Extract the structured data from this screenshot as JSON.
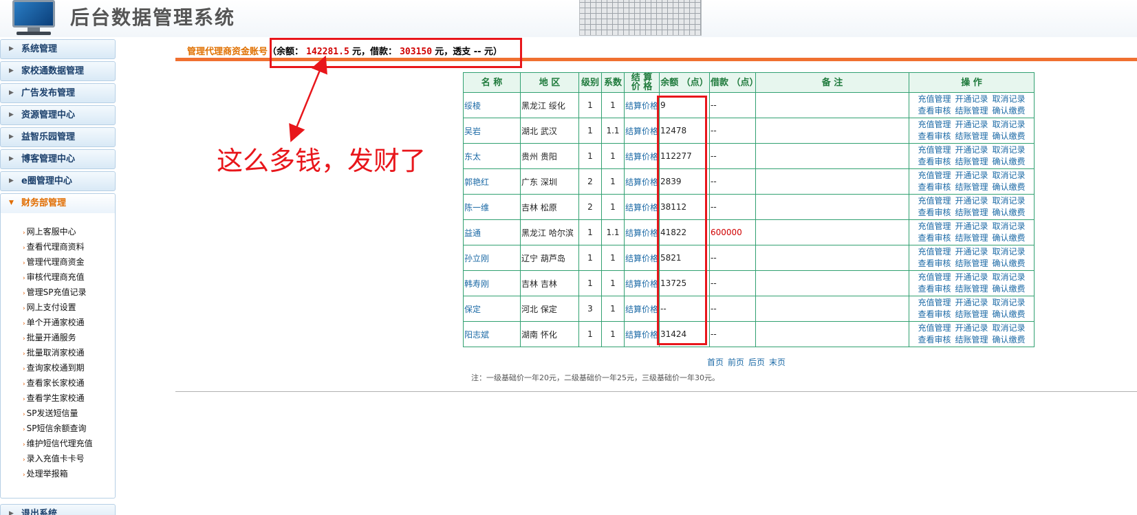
{
  "header": {
    "title": "后台数据管理系统"
  },
  "sidebar": {
    "menus": [
      {
        "label": "系统管理"
      },
      {
        "label": "家校通数据管理"
      },
      {
        "label": "广告发布管理"
      },
      {
        "label": "资源管理中心"
      },
      {
        "label": "益智乐园管理"
      },
      {
        "label": "博客管理中心"
      },
      {
        "label": "e圈管理中心"
      },
      {
        "label": "财务部管理"
      }
    ],
    "finance_items": [
      "网上客服中心",
      "查看代理商资料",
      "管理代理商资金",
      "审核代理商充值",
      "管理SP充值记录",
      "网上支付设置",
      "单个开通家校通",
      "批量开通服务",
      "批量取消家校通",
      "查询家校通到期",
      "查看家长家校通",
      "查看学生家校通",
      "SP发送短信量",
      "SP短信余额查询",
      "维护短信代理充值",
      "录入充值卡卡号",
      "处理举报箱"
    ],
    "exit_label": "退出系统"
  },
  "main": {
    "title_label": "管理代理商资金账号",
    "title_prefix": "（余额：",
    "balance": "142281.5",
    "title_mid1": "元，借款：",
    "loan": "303150",
    "title_mid2": "元，透支 -- 元）"
  },
  "table": {
    "headers": {
      "name": "名 称",
      "region": "地 区",
      "level": "级别",
      "coef": "系数",
      "settle": "结 算 价 格",
      "balance": "余额 （点）",
      "loan": "借款 （点）",
      "remark": "备 注",
      "ops": "操 作"
    },
    "op_labels": [
      "充值管理",
      "开通记录",
      "取消记录",
      "查看审核",
      "结账管理",
      "确认缴费"
    ],
    "rows": [
      {
        "name": "绥棱",
        "region": "黑龙江 绥化",
        "level": "1",
        "coef": "1",
        "settle": "结算价格",
        "balance": "9",
        "loan": "--"
      },
      {
        "name": "吴岩",
        "region": "湖北 武汉",
        "level": "1",
        "coef": "1.1",
        "settle": "结算价格",
        "balance": "12478",
        "loan": "--"
      },
      {
        "name": "东太",
        "region": "贵州 贵阳",
        "level": "1",
        "coef": "1",
        "settle": "结算价格",
        "balance": "112277",
        "loan": "--"
      },
      {
        "name": "郭艳红",
        "region": "广东 深圳",
        "level": "2",
        "coef": "1",
        "settle": "结算价格",
        "balance": "2839",
        "loan": "--"
      },
      {
        "name": "陈一维",
        "region": "吉林 松原",
        "level": "2",
        "coef": "1",
        "settle": "结算价格",
        "balance": "38112",
        "loan": "--"
      },
      {
        "name": "益通",
        "region": "黑龙江 哈尔滨",
        "level": "1",
        "coef": "1.1",
        "settle": "结算价格",
        "balance": "41822",
        "loan": "600000"
      },
      {
        "name": "孙立刚",
        "region": "辽宁 葫芦岛",
        "level": "1",
        "coef": "1",
        "settle": "结算价格",
        "balance": "5821",
        "loan": "--"
      },
      {
        "name": "韩寿刚",
        "region": "吉林 吉林",
        "level": "1",
        "coef": "1",
        "settle": "结算价格",
        "balance": "13725",
        "loan": "--"
      },
      {
        "name": "保定",
        "region": "河北 保定",
        "level": "3",
        "coef": "1",
        "settle": "结算价格",
        "balance": "--",
        "loan": "--"
      },
      {
        "name": "阳志斌",
        "region": "湖南 怀化",
        "level": "1",
        "coef": "1",
        "settle": "结算价格",
        "balance": "31424",
        "loan": "--"
      }
    ]
  },
  "pager": [
    "首页",
    "前页",
    "后页",
    "末页"
  ],
  "note": "注：一级基础价一年20元，二级基础价一年25元，三级基础价一年30元。",
  "annotation": {
    "text": "这么多钱，发财了",
    "color": "#e8161b"
  }
}
